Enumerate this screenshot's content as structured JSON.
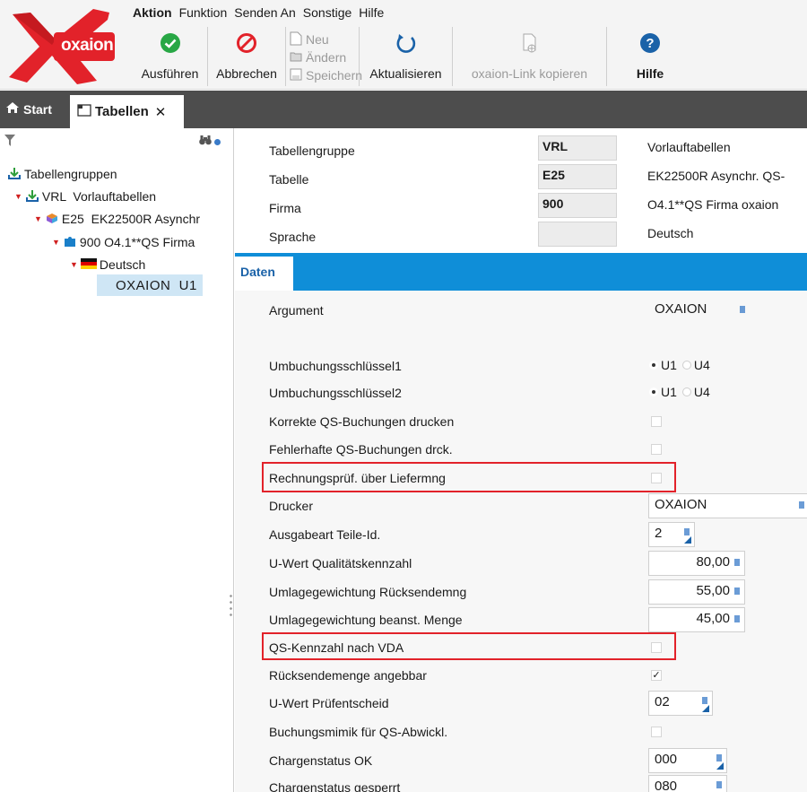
{
  "app": {
    "brand": "oxaion",
    "accent": "#0f8ed8",
    "logo_red": "#e2222a"
  },
  "menu": [
    "Aktion",
    "Funktion",
    "Senden An",
    "Sonstige",
    "Hilfe"
  ],
  "toolbar": {
    "run": "Ausführen",
    "cancel": "Abbrechen",
    "new": "Neu",
    "edit": "Ändern",
    "save": "Speichern",
    "refresh": "Aktualisieren",
    "copy_link": "oxaion-Link kopieren",
    "help": "Hilfe"
  },
  "tabs": {
    "start": "Start",
    "tabellen": "Tabellen",
    "close": "✕"
  },
  "tree": {
    "root": "Tabellengruppen",
    "group": "VRL  Vorlauftabellen",
    "table": "E25  EK22500R Asynchr",
    "company": "900 O4.1**QS Firma",
    "language": "Deutsch",
    "selected": "OXAION  U1"
  },
  "header": {
    "rows": [
      {
        "label": "Tabellengruppe",
        "value": "VRL",
        "desc": "Vorlauftabellen"
      },
      {
        "label": "Tabelle",
        "value": "E25",
        "desc": "EK22500R Asynchr. QS-"
      },
      {
        "label": "Firma",
        "value": "900",
        "desc": "O4.1**QS Firma oxaion"
      },
      {
        "label": "Sprache",
        "value": "",
        "desc": "Deutsch"
      }
    ]
  },
  "daten_tab": "Daten",
  "form": {
    "argument": {
      "label": "Argument",
      "value": "OXAION"
    },
    "umb1": {
      "label": "Umbuchungsschlüssel1",
      "options": [
        "U1",
        "U4"
      ],
      "selected": "U1"
    },
    "umb2": {
      "label": "Umbuchungsschlüssel2",
      "options": [
        "U1",
        "U4"
      ],
      "selected": "U1"
    },
    "korrekte": {
      "label": "Korrekte QS-Buchungen drucken",
      "checked": false
    },
    "fehlerhafte": {
      "label": "Fehlerhafte QS-Buchungen drck.",
      "checked": false
    },
    "rechnung": {
      "label": "Rechnungsprüf. über Liefermng",
      "checked": false
    },
    "drucker": {
      "label": "Drucker",
      "value": "OXAION"
    },
    "ausgabeart": {
      "label": "Ausgabeart Teile-Id.",
      "value": "2"
    },
    "uwert_q": {
      "label": "U-Wert Qualitätskennzahl",
      "value": "80,00"
    },
    "umlage_r": {
      "label": "Umlagegewichtung Rücksendemng",
      "value": "55,00"
    },
    "umlage_b": {
      "label": "Umlagegewichtung beanst. Menge",
      "value": "45,00"
    },
    "qs_vda": {
      "label": "QS-Kennzahl nach VDA",
      "checked": false
    },
    "ruecksende": {
      "label": "Rücksendemenge angebbar",
      "checked": true,
      "checkmark": "✓"
    },
    "uwert_p": {
      "label": "U-Wert Prüfentscheid",
      "value": "02"
    },
    "buchungsmimik": {
      "label": "Buchungsmimik für QS-Abwickl.",
      "checked": false
    },
    "chargen_ok": {
      "label": "Chargenstatus OK",
      "value": "000"
    },
    "chargen_gesperrt": {
      "label": "Chargenstatus gesperrt",
      "value": "080"
    }
  }
}
